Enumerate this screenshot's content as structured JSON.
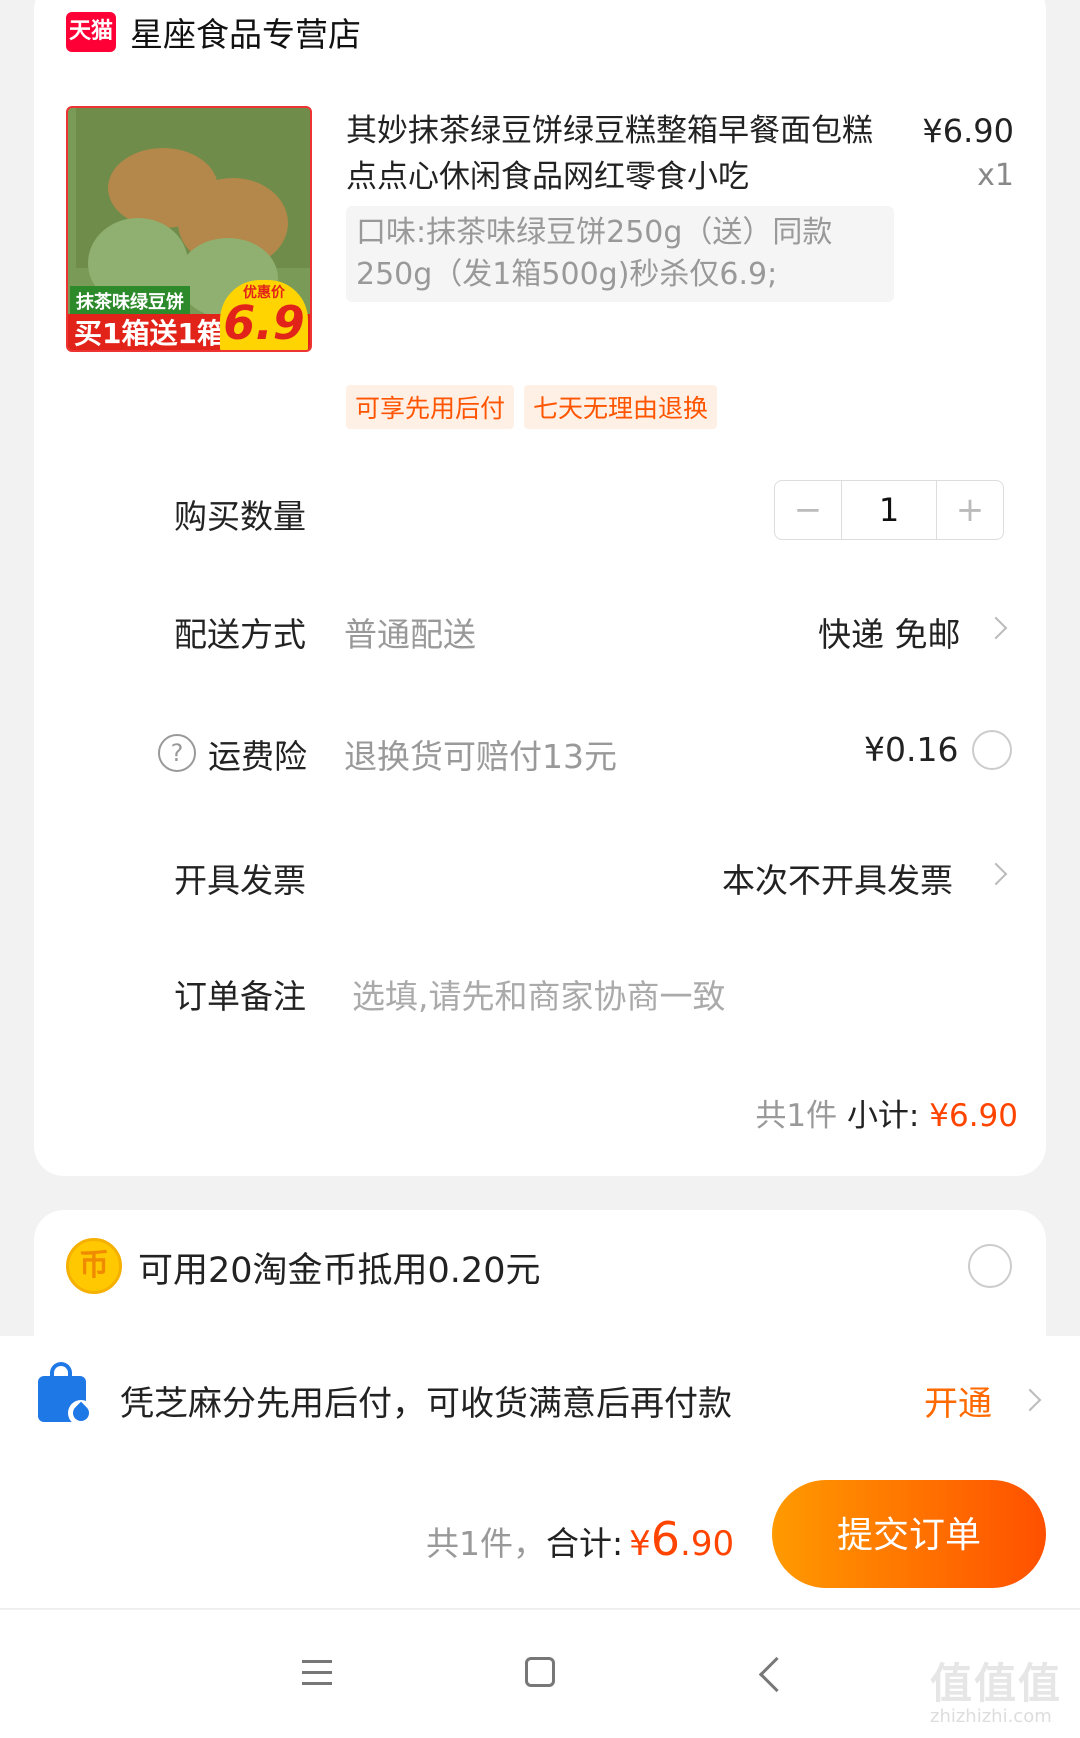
{
  "shop": {
    "logo_text": "天猫",
    "name": "星座食品专营店"
  },
  "product": {
    "title": "其妙抹茶绿豆饼绿豆糕整箱早餐面包糕点点心休闲食品网红零食小吃",
    "price": "¥6.90",
    "qty": "x1",
    "sku": "口味:抹茶味绿豆饼250g（送）同款250g（发1箱500g)秒杀仅6.9;",
    "image": {
      "tag_green": "抹茶味绿豆饼",
      "tag_red": "买1箱送1箱",
      "badge_top": "优惠价",
      "badge_price": "6.9"
    },
    "service_tags": [
      "可享先用后付",
      "七天无理由退换"
    ]
  },
  "quantity": {
    "label": "购买数量",
    "minus": "−",
    "value": "1",
    "plus": "+"
  },
  "delivery": {
    "label": "配送方式",
    "sub": "普通配送",
    "value": "快递 免邮"
  },
  "insurance": {
    "label": "运费险",
    "sub": "退换货可赔付13元",
    "value": "¥0.16"
  },
  "invoice": {
    "label": "开具发票",
    "value": "本次不开具发票"
  },
  "remark": {
    "label": "订单备注",
    "placeholder": "选填,请先和商家协商一致"
  },
  "subtotal": {
    "count": "共1件",
    "label": "小计:",
    "price": "¥6.90"
  },
  "coins": {
    "text": "可用20淘金币抵用0.20元",
    "icon_glyph": "币"
  },
  "paylater": {
    "text": "凭芝麻分先用后付，可收货满意后再付款",
    "action": "开通"
  },
  "total": {
    "count": "共1件，",
    "label": "合计:",
    "currency": "¥",
    "integer": "6",
    "decimal": ".90"
  },
  "submit": {
    "label": "提交订单"
  },
  "watermark": {
    "text": "值值值",
    "sub": "zhizhizhi.com"
  },
  "colors": {
    "accent": "#ff5000",
    "price": "#ff4400",
    "tmall": "#ff0036",
    "blue": "#1e78e6"
  }
}
